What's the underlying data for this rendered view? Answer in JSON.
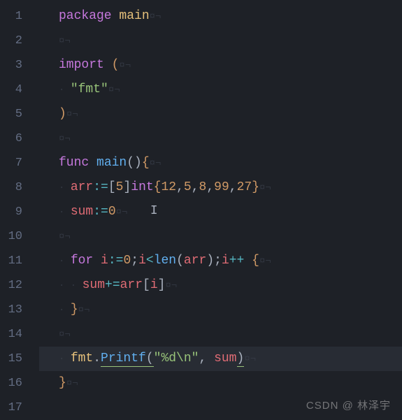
{
  "gutter": {
    "lines": [
      "1",
      "2",
      "3",
      "4",
      "5",
      "6",
      "7",
      "8",
      "9",
      "10",
      "11",
      "12",
      "13",
      "14",
      "15",
      "16",
      "17"
    ]
  },
  "code": {
    "l1_package": "package",
    "l1_main": " main",
    "l3_import": "import",
    "l3_paren": " (",
    "l4_indent": "  ",
    "l4_str": "\"fmt\"",
    "l5_paren": ")",
    "l7_func": "func",
    "l7_main": " main",
    "l7_sig": "()",
    "l7_brace": "{",
    "l8_indent": "  ",
    "l8_arr": "arr",
    "l8_assign": ":=",
    "l8_lbracket": "[",
    "l8_size": "5",
    "l8_rbracket": "]",
    "l8_int": "int",
    "l8_lbrace": "{",
    "l8_v1": "12",
    "l8_v2": "5",
    "l8_v3": "8",
    "l8_v4": "99",
    "l8_v5": "27",
    "l8_rbrace": "}",
    "l8_c": ",",
    "l9_indent": "  ",
    "l9_sum": "sum",
    "l9_assign": ":=",
    "l9_zero": "0",
    "l11_indent": "  ",
    "l11_for": "for",
    "l11_i": " i",
    "l11_a1": ":=",
    "l11_z": "0",
    "l11_semi": ";",
    "l11_i2": "i",
    "l11_lt": "<",
    "l11_len": "len",
    "l11_lp": "(",
    "l11_arr": "arr",
    "l11_rp": ")",
    "l11_semi2": ";",
    "l11_i3": "i",
    "l11_pp": "++",
    "l11_spc": " ",
    "l11_brace": "{",
    "l12_indent": "    ",
    "l12_sum": "sum",
    "l12_pe": "+=",
    "l12_arr": "arr",
    "l12_lb": "[",
    "l12_i": "i",
    "l12_rb": "]",
    "l13_indent": "  ",
    "l13_brace": "}",
    "l15_indent": "  ",
    "l15_fmt": "fmt",
    "l15_dot": ".",
    "l15_printf": "Printf",
    "l15_lp": "(",
    "l15_fmtstr": "\"%d\\n\"",
    "l15_comma": ",",
    "l15_sum": " sum",
    "l15_rp": ")",
    "l16_brace": "}"
  },
  "whitespace_markers": {
    "eol": "¤¬",
    "dot": "·"
  },
  "watermark": "CSDN @ 林泽宇"
}
